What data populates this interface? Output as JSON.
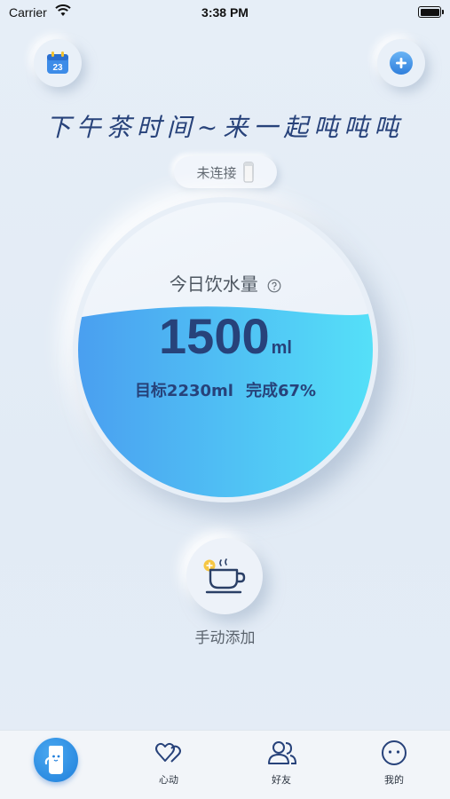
{
  "status_bar": {
    "carrier": "Carrier",
    "time": "3:38 PM"
  },
  "header": {
    "calendar_day": "23",
    "headline": "下午茶时间~来一起吨吨吨"
  },
  "device": {
    "status": "未连接"
  },
  "intake": {
    "label": "今日饮水量",
    "amount": "1500",
    "unit": "ml",
    "goal_text": "目标2230ml",
    "progress_text": "完成67%",
    "progress_fraction": 0.67
  },
  "manual_add": {
    "label": "手动添加"
  },
  "tabs": [
    {
      "label": "",
      "icon": "bottle-mascot-icon"
    },
    {
      "label": "心动",
      "icon": "hearts-icon"
    },
    {
      "label": "好友",
      "icon": "friends-icon"
    },
    {
      "label": "我的",
      "icon": "smiley-icon"
    }
  ],
  "colors": {
    "accent": "#27427a",
    "water_start": "#4a9ff0",
    "water_end": "#55e0f8",
    "tab_active": "#1f7fdb"
  }
}
